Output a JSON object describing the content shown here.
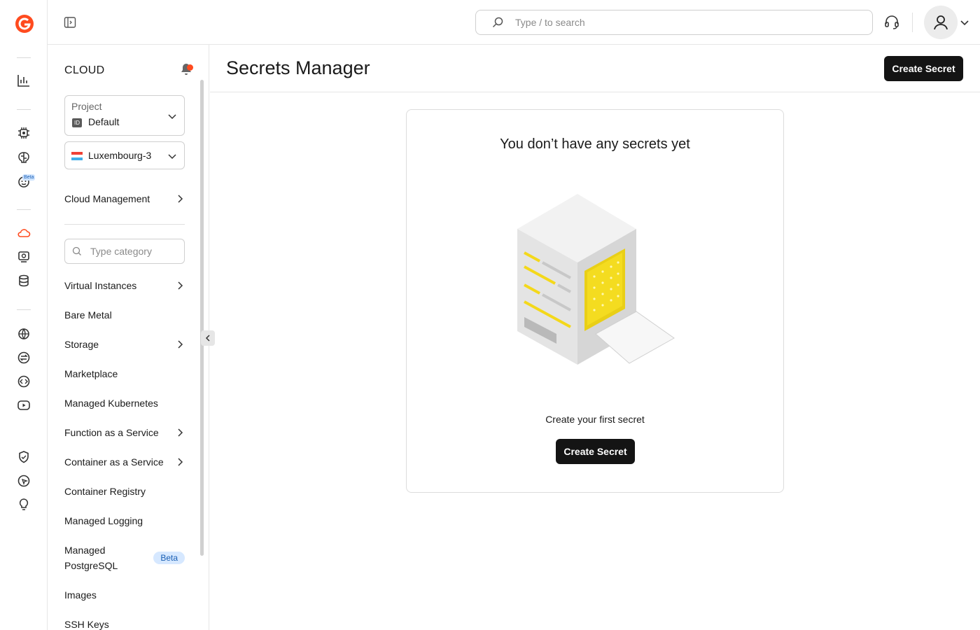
{
  "topbar": {
    "search_placeholder": "Type / to search"
  },
  "rail": {
    "icons": [
      "logo-icon",
      "stats-icon",
      "chip-icon",
      "brain-icon",
      "bot-icon",
      "cloud-icon",
      "server-monitor-icon",
      "database-icon",
      "globe-icon",
      "exchange-icon",
      "code-icon",
      "video-icon",
      "shield-icon",
      "pointer-icon",
      "bulb-icon"
    ],
    "beta_label": "Beta",
    "accent": "#ff4b1f"
  },
  "sidebar": {
    "title": "CLOUD",
    "project": {
      "label": "Project",
      "id_badge": "ID",
      "value": "Default"
    },
    "region": {
      "value": "Luxembourg-3"
    },
    "cloud_management": "Cloud Management",
    "category_placeholder": "Type category",
    "items": [
      {
        "label": "Virtual Instances",
        "chevron": true
      },
      {
        "label": "Bare Metal",
        "chevron": false
      },
      {
        "label": "Storage",
        "chevron": true
      },
      {
        "label": "Marketplace",
        "chevron": false
      },
      {
        "label": "Managed Kubernetes",
        "chevron": false
      },
      {
        "label": "Function as a Service",
        "chevron": true
      },
      {
        "label": "Container as a Service",
        "chevron": true
      },
      {
        "label": "Container Registry",
        "chevron": false
      },
      {
        "label": "Managed Logging",
        "chevron": false
      },
      {
        "label": "Managed",
        "label2": "PostgreSQL",
        "badge": "Beta"
      },
      {
        "label": "Images",
        "chevron": false
      },
      {
        "label": "SSH Keys",
        "chevron": false
      }
    ]
  },
  "main": {
    "title": "Secrets Manager",
    "create_button": "Create Secret",
    "empty": {
      "title": "You don’t have any secrets yet",
      "subtitle": "Create your first secret",
      "button": "Create Secret"
    }
  }
}
